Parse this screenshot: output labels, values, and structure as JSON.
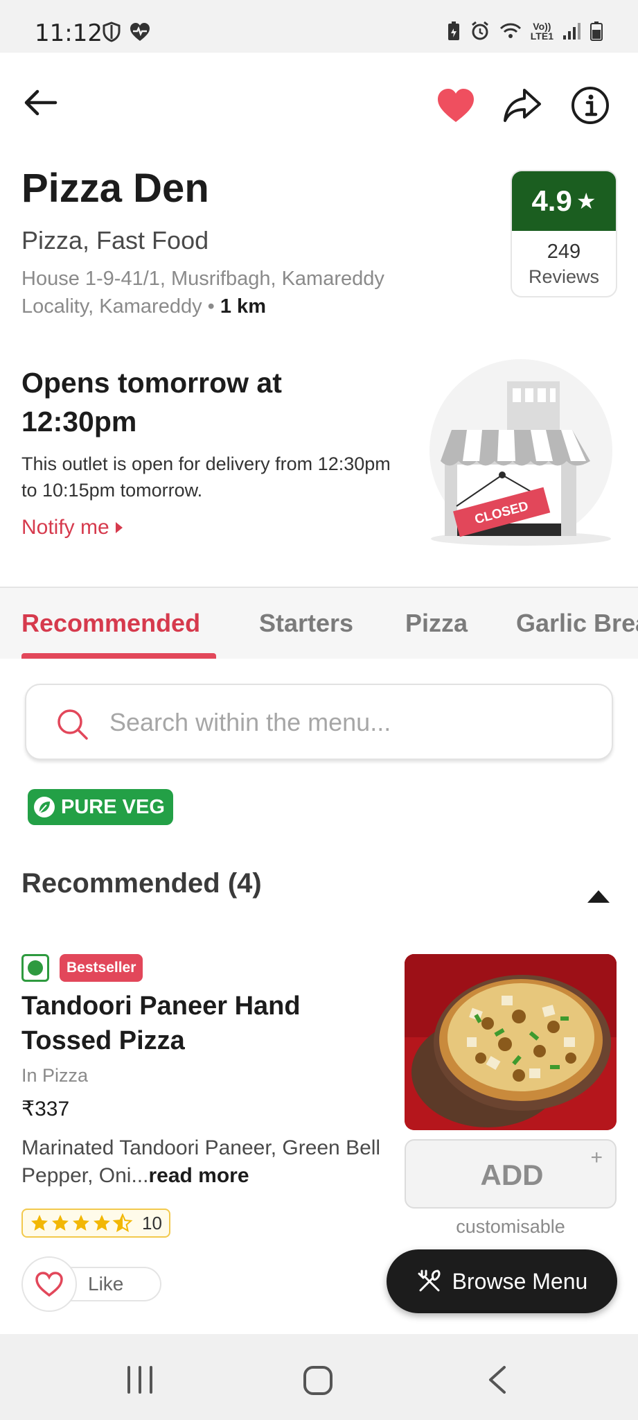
{
  "status_bar": {
    "time": "11:12",
    "network_label_top": "Vo))",
    "network_label_bottom": "LTE1"
  },
  "restaurant": {
    "name": "Pizza Den",
    "cuisine": "Pizza, Fast Food",
    "address": "House 1-9-41/1, Musrifbagh, Kamareddy Locality, Kamareddy",
    "separator": "•",
    "distance": "1 km",
    "rating": "4.9",
    "rating_star": "★",
    "reviews_count": "249",
    "reviews_label": "Reviews",
    "favorited": true
  },
  "status": {
    "title": "Opens tomorrow at 12:30pm",
    "description": "This outlet is open for delivery from 12:30pm to 10:15pm tomorrow.",
    "notify_label": "Notify me",
    "sign_text": "CLOSED"
  },
  "tabs": [
    {
      "label": "Recommended",
      "active": true
    },
    {
      "label": "Starters",
      "active": false
    },
    {
      "label": "Pizza",
      "active": false
    },
    {
      "label": "Garlic Bread",
      "active": false
    }
  ],
  "search": {
    "placeholder": "Search within the menu..."
  },
  "badges": {
    "pure_veg": "PURE VEG"
  },
  "section": {
    "title": "Recommended (4)",
    "expanded": true
  },
  "item": {
    "veg": true,
    "badge": "Bestseller",
    "name": "Tandoori Paneer Hand Tossed Pizza",
    "category": "In Pizza",
    "price": "₹337",
    "description": "Marinated Tandoori Paneer, Green Bell Pepper, Oni...",
    "read_more": "read more",
    "rating_value": 4.5,
    "rating_count": "10",
    "like_label": "Like",
    "add_label": "ADD",
    "add_plus": "+",
    "customisable_label": "customisable"
  },
  "browse_menu": {
    "label": "Browse Menu"
  },
  "colors": {
    "accent": "#e2475a",
    "rating_green": "#1b5e20",
    "veg_green": "#23a046"
  }
}
